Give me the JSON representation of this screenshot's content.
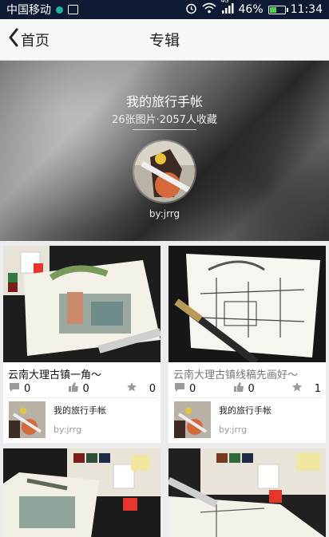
{
  "status_bar": {
    "carrier": "中国移动",
    "network": "4G",
    "battery": "46%",
    "battery_level": 0.46,
    "time": "11:34"
  },
  "header": {
    "back_label": "首页",
    "title": "专辑"
  },
  "album": {
    "title": "我的旅行手帐",
    "stats": "26张图片·2057人收藏",
    "author": "by:jrrg"
  },
  "cards": [
    {
      "title": "云南大理古镇一角～",
      "comments": "0",
      "likes": "0",
      "stars": "0",
      "album_name": "我的旅行手帐",
      "by": "by:jrrg"
    },
    {
      "title": "云南大理古镇线稿先画好～",
      "comments": "0",
      "likes": "0",
      "stars": "1",
      "album_name": "我的旅行手帐",
      "by": "by:jrrg"
    }
  ],
  "icons": {
    "back": "chevron-left-icon",
    "comment": "comment-icon",
    "like": "thumbs-up-icon",
    "star": "star-icon"
  },
  "colors": {
    "status_bar": "#0e1a33",
    "title_bar": "#f7f7f7",
    "background": "#ececec",
    "icon_gray": "#9a9a9a"
  }
}
